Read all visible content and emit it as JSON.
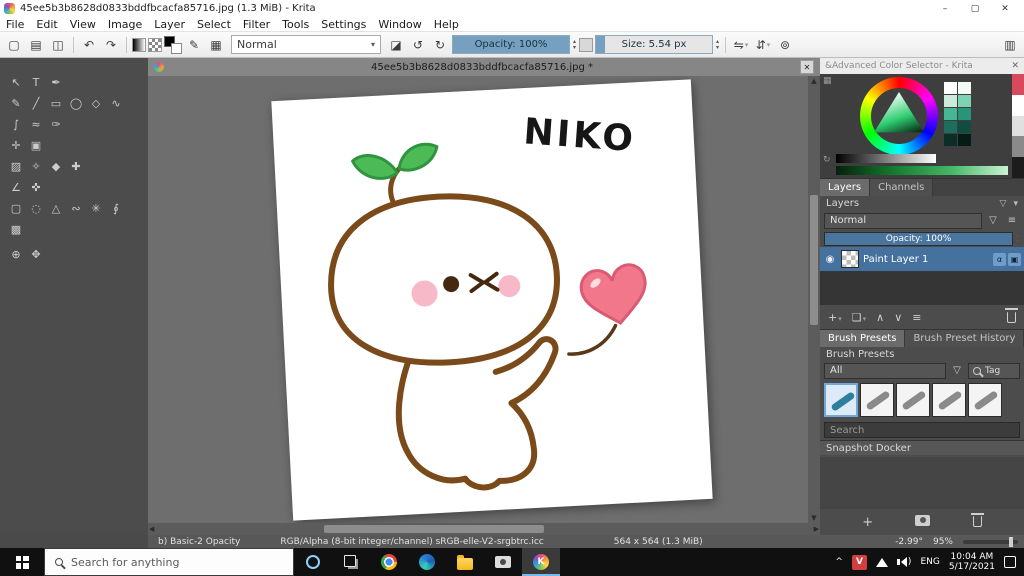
{
  "window": {
    "title": "45ee5b3b8628d0833bddfbcacfa85716.jpg (1.3 MiB) - Krita"
  },
  "menubar": [
    "File",
    "Edit",
    "View",
    "Image",
    "Layer",
    "Select",
    "Filter",
    "Tools",
    "Settings",
    "Window",
    "Help"
  ],
  "toolbar": {
    "blend_mode": "Normal",
    "opacity_label": "Opacity: 100%",
    "size_label": "Size: 5.54 px"
  },
  "toolbox": {
    "rows": [
      [
        {
          "name": "transform-tool",
          "glyph": "↖"
        },
        {
          "name": "text-tool",
          "glyph": "T"
        },
        {
          "name": "calligraphy-tool",
          "glyph": "✒"
        }
      ],
      [
        {
          "name": "freehand-brush-tool",
          "glyph": "✎"
        },
        {
          "name": "line-tool",
          "glyph": "╱"
        },
        {
          "name": "rectangle-tool",
          "glyph": "▭"
        },
        {
          "name": "ellipse-tool",
          "glyph": "◯"
        },
        {
          "name": "polygon-tool",
          "glyph": "◇"
        },
        {
          "name": "polyline-tool",
          "glyph": "∿"
        }
      ],
      [
        {
          "name": "bezier-curve-tool",
          "glyph": "∫"
        },
        {
          "name": "freehand-path-tool",
          "glyph": "≈"
        },
        {
          "name": "dynamic-brush-tool",
          "glyph": "✑"
        }
      ],
      [
        {
          "name": "move-tool",
          "glyph": "✛"
        },
        {
          "name": "crop-tool",
          "glyph": "▣"
        }
      ],
      [
        {
          "name": "gradient-tool",
          "glyph": "▨"
        },
        {
          "name": "color-sampler-tool",
          "glyph": "✧"
        },
        {
          "name": "fill-tool",
          "glyph": "◆"
        },
        {
          "name": "smart-patch-tool",
          "glyph": "✚"
        }
      ],
      [
        {
          "name": "measure-tool",
          "glyph": "∠"
        },
        {
          "name": "assistants-tool",
          "glyph": "✜"
        }
      ],
      [
        {
          "name": "rect-select-tool",
          "glyph": "▢"
        },
        {
          "name": "ellipse-select-tool",
          "glyph": "◌"
        },
        {
          "name": "polygon-select-tool",
          "glyph": "△"
        },
        {
          "name": "freehand-select-tool",
          "glyph": "∾"
        },
        {
          "name": "similar-select-tool",
          "glyph": "✳"
        },
        {
          "name": "bezier-select-tool",
          "glyph": "∮"
        }
      ],
      [
        {
          "name": "magnetic-select-tool",
          "glyph": "▩"
        }
      ],
      [
        {
          "name": "zoom-tool",
          "glyph": "⊕"
        },
        {
          "name": "pan-tool",
          "glyph": "✥"
        }
      ]
    ]
  },
  "canvas": {
    "tab_title": "45ee5b3b8628d0833bddfbcacfa85716.jpg *",
    "artwork_text": "NIKO"
  },
  "color_selector": {
    "title": "&Advanced Color Selector - Krita",
    "swatches": [
      "#ffffff",
      "#f2faf6",
      "#cdebdd",
      "#7fd2b4",
      "#46b694",
      "#2a9478",
      "#1c6f5c",
      "#124c40",
      "#0b2e27",
      "#061a16"
    ],
    "strip": [
      "#d8495e",
      "#ffffff",
      "#e0e0e0",
      "#8a8a8a",
      "#1c1c1c"
    ]
  },
  "layers": {
    "tab_layers": "Layers",
    "tab_channels": "Channels",
    "section_title": "Layers",
    "blend_mode": "Normal",
    "opacity_label": "Opacity:  100%",
    "layer_name": "Paint Layer 1"
  },
  "brushes": {
    "tab_presets": "Brush Presets",
    "tab_history": "Brush Preset History",
    "section_title": "Brush Presets",
    "filter_value": "All",
    "tag_label": "Tag",
    "search_placeholder": "Search",
    "tiles": [
      {
        "color": "#2e7f9e",
        "selected": true
      },
      {
        "color": "#8a8a8a"
      },
      {
        "color": "#8a8a8a"
      },
      {
        "color": "#8a8a8a"
      },
      {
        "color": "#8a8a8a"
      }
    ]
  },
  "snapshot": {
    "title": "Snapshot Docker"
  },
  "statusbar": {
    "brush_name": "b) Basic-2 Opacity",
    "color_profile": "RGB/Alpha (8-bit integer/channel)  sRGB-elle-V2-srgbtrc.icc",
    "canvas_size": "564 x 564 (1.3 MiB)",
    "angle": "-2.99°",
    "zoom": "95%"
  },
  "taskbar": {
    "search_placeholder": "Search for anything",
    "language": "ENG",
    "time": "10:04 AM",
    "date": "5/17/2021"
  }
}
